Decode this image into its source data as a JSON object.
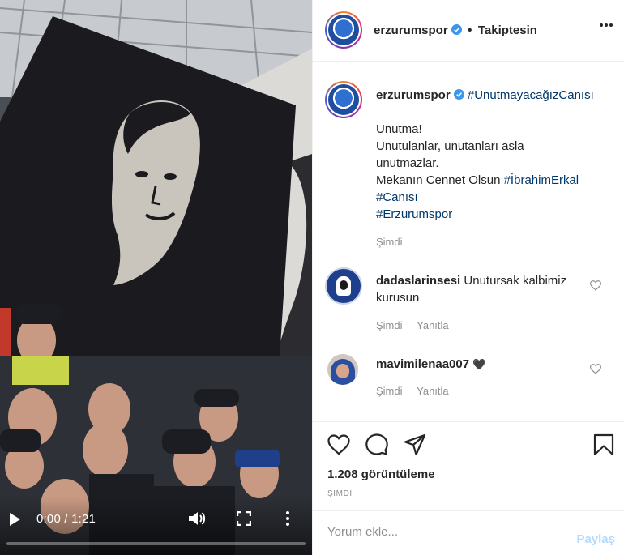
{
  "video": {
    "time_display": "0:00 / 1:21",
    "progress_fraction": 0
  },
  "header": {
    "username": "erzurumspor",
    "separator": "•",
    "follow_status": "Takiptesin"
  },
  "caption": {
    "username": "erzurumspor",
    "hashtag_inline": "#UnutmayacağızCanısı",
    "lines": [
      "Unutma!",
      "Unutulanlar, unutanları asla",
      "unutmazlar."
    ],
    "line_prefix": "Mekanın Cennet Olsun ",
    "hashtag_name": "#İbrahimErkal",
    "hashtag_2": "#Canısı",
    "hashtag_3": "#Erzurumspor",
    "time": "Şimdi"
  },
  "comments": [
    {
      "username": "dadaslarinsesi",
      "text_line1": "Unutursak kalbimiz",
      "text_line2": "kurusun",
      "time": "Şimdi",
      "reply": "Yanıtla"
    },
    {
      "username": "mavimilenaa007",
      "emoji": "🖤",
      "time": "Şimdi",
      "reply": "Yanıtla"
    }
  ],
  "stats": {
    "views": "1.208 görüntüleme",
    "date": "ŞİMDİ"
  },
  "comment_box": {
    "placeholder": "Yorum ekle...",
    "post_label": "Paylaş"
  },
  "icons": [
    "play-icon",
    "volume-icon",
    "fullscreen-icon",
    "more-vertical-icon",
    "verified-icon",
    "more-horizontal-icon",
    "heart-icon",
    "comment-icon",
    "share-icon",
    "bookmark-icon"
  ],
  "colors": {
    "link": "#00376b",
    "verified": "#3897f0",
    "post_button_disabled": "#b3dbff",
    "muted": "#8e8e8e"
  }
}
